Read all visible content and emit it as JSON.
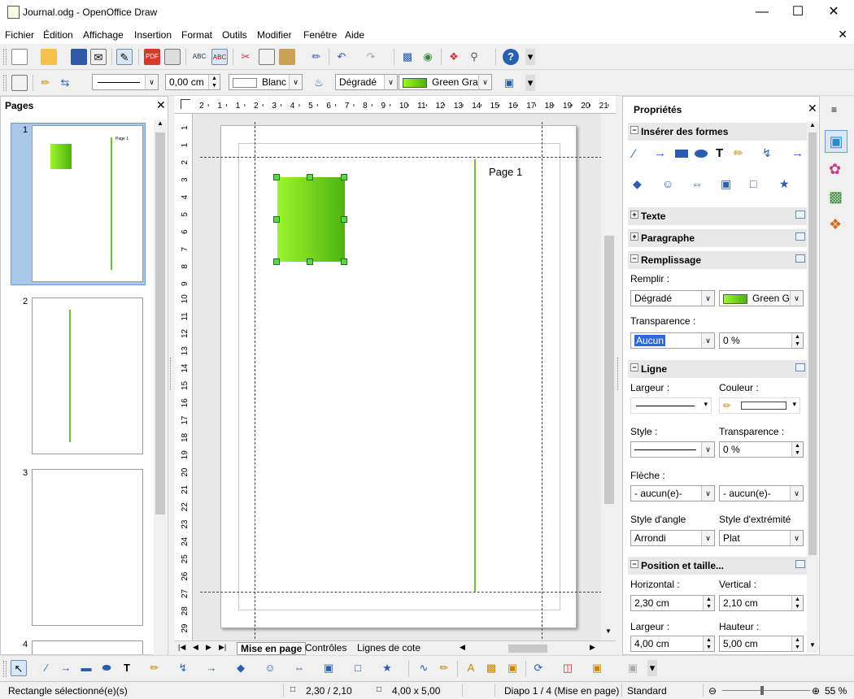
{
  "window": {
    "title": "Journal.odg - OpenOffice Draw"
  },
  "menu": {
    "items": [
      "Fichier",
      "Édition",
      "Affichage",
      "Insertion",
      "Format",
      "Outils",
      "Modifier",
      "Fenêtre",
      "Aide"
    ]
  },
  "line_toolbar": {
    "line_width": "0,00 cm",
    "line_color": "Blanc",
    "fill_style": "Dégradé",
    "fill_value": "Green Grac"
  },
  "pages_pane": {
    "title": "Pages",
    "pages": [
      {
        "number": "1",
        "label": "Page 1"
      },
      {
        "number": "2"
      },
      {
        "number": "3"
      },
      {
        "number": "4"
      }
    ]
  },
  "ruler": {
    "h_labels": [
      "2",
      "1",
      "1",
      "2",
      "3",
      "4",
      "5",
      "6",
      "7",
      "8",
      "9",
      "10",
      "11",
      "12",
      "13",
      "14",
      "15",
      "16",
      "17",
      "18",
      "19",
      "20",
      "21"
    ],
    "v_labels": [
      "1",
      "1",
      "2",
      "3",
      "4",
      "5",
      "6",
      "7",
      "8",
      "9",
      "10",
      "11",
      "12",
      "13",
      "14",
      "15",
      "16",
      "17",
      "18",
      "19",
      "20",
      "21",
      "22",
      "23",
      "24",
      "25",
      "26",
      "27",
      "28",
      "29"
    ]
  },
  "document": {
    "page_label": "Page 1"
  },
  "tabs": {
    "items": [
      "Mise en page",
      "Contrôles",
      "Lignes de cote"
    ]
  },
  "sidebar": {
    "title": "Propriétés",
    "sections": {
      "shapes": "Insérer des formes",
      "text": "Texte",
      "paragraph": "Paragraphe",
      "fill": "Remplissage",
      "line": "Ligne",
      "position": "Position et taille..."
    },
    "fill": {
      "fill_label": "Remplir :",
      "fill_type": "Dégradé",
      "gradient": "Green Gr",
      "transparency_label": "Transparence :",
      "transparency_type": "Aucun",
      "transparency_value": "0 %"
    },
    "line": {
      "width_label": "Largeur :",
      "color_label": "Couleur :",
      "style_label": "Style :",
      "transparency_label": "Transparence :",
      "transparency_value": "0 %",
      "arrow_label": "Flèche :",
      "arrow_start": "- aucun(e)-",
      "arrow_end": "- aucun(e)-",
      "corner_label": "Style d'angle",
      "corner_value": "Arrondi",
      "cap_label": "Style d'extrémité",
      "cap_value": "Plat"
    },
    "position": {
      "horizontal_label": "Horizontal :",
      "horizontal": "2,30 cm",
      "vertical_label": "Vertical :",
      "vertical": "2,10 cm",
      "width_label": "Largeur :",
      "width": "4,00 cm",
      "height_label": "Hauteur :",
      "height": "5,00 cm"
    }
  },
  "status": {
    "selection": "Rectangle sélectionné(e)(s)",
    "position": "2,30 / 2,10",
    "size": "4,00 x 5,00",
    "slide": "Diapo 1 / 4 (Mise en page)",
    "layout": "Standard",
    "zoom": "55 %"
  },
  "colors": {
    "gradient_start": "#9cf52d",
    "gradient_end": "#4eb30f",
    "line_green": "#6cbf3a",
    "selection_blue": "#2a6ad4"
  }
}
